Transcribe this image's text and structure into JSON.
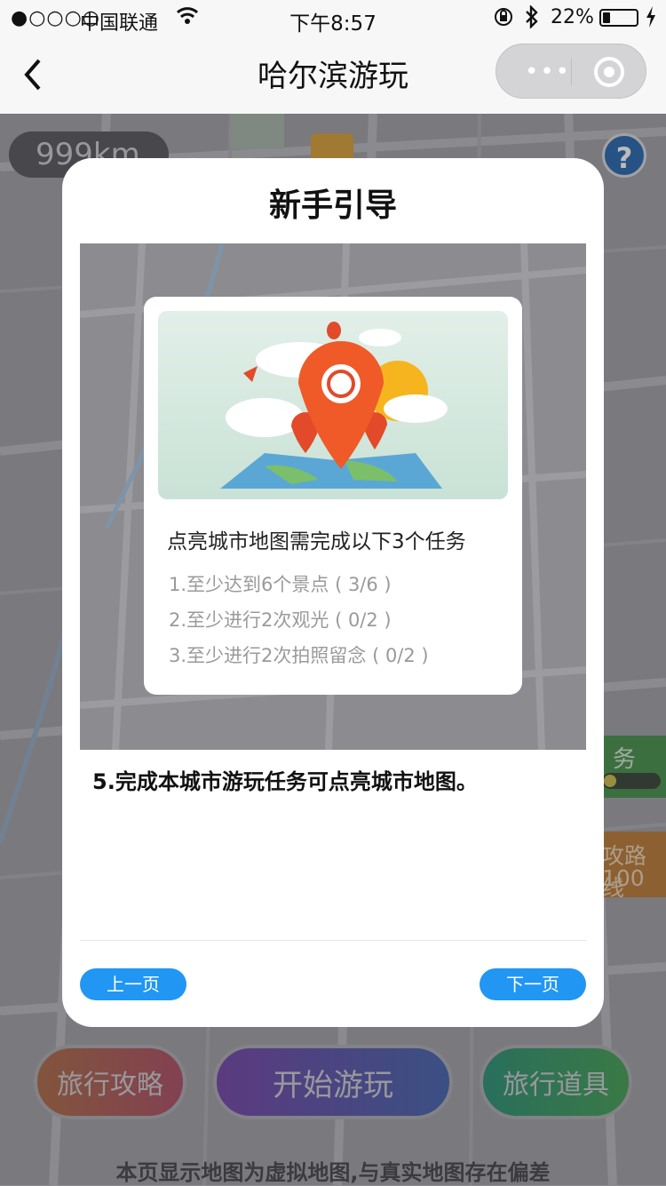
{
  "status_bar": {
    "signal": "●○○○○",
    "carrier": "中国联通",
    "time": "下午8:57",
    "battery_percent": "22%",
    "battery_level": 0.22
  },
  "nav": {
    "title": "哈尔滨游玩",
    "capsule_dots": "•••"
  },
  "map": {
    "distance": "999km",
    "help_label": "?",
    "task_chip_label": "务",
    "route_chip_line1": "攻路线",
    "route_chip_line2": "100"
  },
  "bottom_buttons": {
    "guide": "旅行攻略",
    "start": "开始游玩",
    "props": "旅行道具"
  },
  "disclaimer": "本页显示地图为虚拟地图,与真实地图存在偏差",
  "modal": {
    "title": "新手引导",
    "card_heading": "点亮城市地图需完成以下3个任务",
    "tasks": [
      "1.至少达到6个景点 ( 3/6 )",
      "2.至少进行2次观光 ( 0/2 )",
      "3.至少进行2次拍照留念 ( 0/2 )"
    ],
    "step_text": "5.完成本城市游玩任务可点亮城市地图。",
    "prev_label": "上一页",
    "next_label": "下一页"
  },
  "colors": {
    "accent_blue": "#2196f3",
    "pin_red": "#e8492a",
    "sun_yellow": "#f6b51e"
  }
}
